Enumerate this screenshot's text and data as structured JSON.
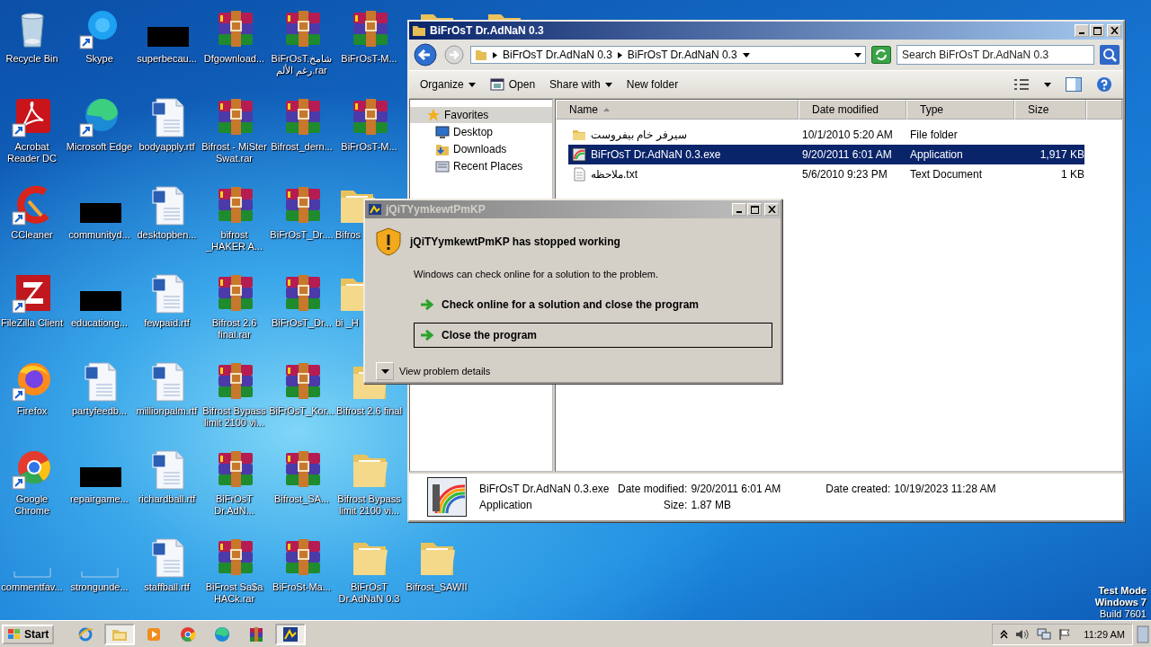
{
  "desktop": {
    "columns": [
      [
        {
          "label": "Recycle Bin",
          "kind": "recycle",
          "shortcut": false
        },
        {
          "label": "Acrobat Reader DC",
          "kind": "acrobat",
          "shortcut": true
        },
        {
          "label": "CCleaner",
          "kind": "ccleaner",
          "shortcut": true
        },
        {
          "label": "FileZilla Client",
          "kind": "filezilla",
          "shortcut": true
        },
        {
          "label": "Firefox",
          "kind": "firefox",
          "shortcut": true
        },
        {
          "label": "Google Chrome",
          "kind": "chrome",
          "shortcut": true
        },
        {
          "label": "commentfav...",
          "kind": "blank",
          "shortcut": false
        }
      ],
      [
        {
          "label": "Skype",
          "kind": "skype",
          "shortcut": true
        },
        {
          "label": "Microsoft Edge",
          "kind": "edge",
          "shortcut": true
        },
        {
          "label": "communityd...",
          "kind": "redacted",
          "shortcut": false
        },
        {
          "label": "educationg...",
          "kind": "redacted",
          "shortcut": false
        },
        {
          "label": "partyfeedb...",
          "kind": "word",
          "shortcut": false
        },
        {
          "label": "repairgame...",
          "kind": "redacted",
          "shortcut": false
        },
        {
          "label": "strongunde...",
          "kind": "blank",
          "shortcut": false
        }
      ],
      [
        {
          "label": "superbecau...",
          "kind": "redacted",
          "shortcut": false
        },
        {
          "label": "bodyapply.rtf",
          "kind": "word",
          "shortcut": false
        },
        {
          "label": "desktopben...",
          "kind": "word",
          "shortcut": false
        },
        {
          "label": "fewpaid.rtf",
          "kind": "word",
          "shortcut": false
        },
        {
          "label": "millionpalm.rtf",
          "kind": "word",
          "shortcut": false
        },
        {
          "label": "richardball.rtf",
          "kind": "word",
          "shortcut": false
        },
        {
          "label": "staffball.rtf",
          "kind": "word",
          "shortcut": false
        }
      ],
      [
        {
          "label": "Dfgownload...",
          "kind": "winrar",
          "shortcut": false
        },
        {
          "label": "Bifrost - MiSter Swat.rar",
          "kind": "winrar",
          "shortcut": false
        },
        {
          "label": "bifrost _HAKER A...",
          "kind": "winrar",
          "shortcut": false
        },
        {
          "label": "Bifrost 2.6 final.rar",
          "kind": "winrar",
          "shortcut": false
        },
        {
          "label": "Bifrost Bypass limit 2100 vi...",
          "kind": "winrar",
          "shortcut": false
        },
        {
          "label": "BiFrOsT Dr.AdN...",
          "kind": "winrar",
          "shortcut": false
        },
        {
          "label": "BiFrost Sa$a HACk.rar",
          "kind": "winrar",
          "shortcut": false
        }
      ],
      [
        {
          "label": "BiFrOsT.شامخ رغم الألم.rar",
          "kind": "winrar",
          "shortcut": false
        },
        {
          "label": "Bifrost_dern...",
          "kind": "winrar",
          "shortcut": false
        },
        {
          "label": "BiFrOsT_Dr....",
          "kind": "winrar",
          "shortcut": false
        },
        {
          "label": "BiFrOsT_Dr...",
          "kind": "winrar",
          "shortcut": false
        },
        {
          "label": "BiFrOsT_Kor...",
          "kind": "winrar",
          "shortcut": false
        },
        {
          "label": "Bifrost_SA...",
          "kind": "winrar",
          "shortcut": false
        },
        {
          "label": "BiFroSt-Ma...",
          "kind": "winrar",
          "shortcut": false
        }
      ],
      [
        {
          "label": "BiFrOsT-M...",
          "kind": "winrar",
          "shortcut": false
        },
        {
          "label": "BiFrOsT-M...",
          "kind": "winrar",
          "shortcut": false
        },
        {
          "label": "Bifros",
          "kind": "folder",
          "shortcut": false
        },
        {
          "label": "bi _H",
          "kind": "folder",
          "shortcut": false
        },
        {
          "label": "Bifrost 2.6 final",
          "kind": "folder",
          "shortcut": false
        },
        {
          "label": "Bifrost Bypass limit 2100 vi...",
          "kind": "folder",
          "shortcut": false
        },
        {
          "label": "BiFrOsT Dr.AdNaN 0.3",
          "kind": "folder",
          "shortcut": false
        }
      ],
      [
        {
          "kind": "folder"
        },
        null,
        null,
        null,
        null,
        null,
        {
          "label": "Bifrost_SAWII",
          "kind": "folder",
          "shortcut": false
        }
      ],
      [
        {
          "kind": "folder"
        }
      ]
    ]
  },
  "explorer": {
    "title": "BiFrOsT Dr.AdNaN 0.3",
    "address": [
      "BiFrOsT Dr.AdNaN 0.3",
      "BiFrOsT Dr.AdNaN 0.3"
    ],
    "search": {
      "placeholder": "Search BiFrOsT Dr.AdNaN 0.3"
    },
    "toolbar": [
      {
        "label": "Organize",
        "kind": "menu"
      },
      {
        "label": "Open",
        "kind": "icon"
      },
      {
        "label": "Share with",
        "kind": "menu"
      },
      {
        "label": "New folder",
        "kind": "plain"
      }
    ],
    "nav": [
      {
        "label": "Favorites",
        "kind": "group",
        "selected": true
      },
      {
        "label": "Desktop",
        "kind": "desktop",
        "selected": false
      },
      {
        "label": "Downloads",
        "kind": "downloads",
        "selected": false
      },
      {
        "label": "Recent Places",
        "kind": "recent",
        "selected": false
      }
    ],
    "columns": [
      {
        "label": "Name",
        "sorted": true
      },
      {
        "label": "Date modified",
        "sorted": false
      },
      {
        "label": "Type",
        "sorted": false
      },
      {
        "label": "Size",
        "sorted": false
      }
    ],
    "files": [
      {
        "name": "سيرفر خام بيفروست",
        "date": "10/1/2010 5:20 AM",
        "type": "File folder",
        "kind": "folder",
        "selected": false
      },
      {
        "name": "BiFrOsT Dr.AdNaN 0.3.exe",
        "date": "9/20/2011 6:01 AM",
        "type": "Application",
        "size": "1,917 KB",
        "kind": "exe",
        "selected": true
      },
      {
        "name": "ملاحظه.txt",
        "date": "5/6/2010 9:23 PM",
        "type": "Text Document",
        "size": "1 KB",
        "kind": "text",
        "selected": false
      }
    ],
    "details": {
      "name": "BiFrOsT Dr.AdNaN 0.3.exe",
      "type": "Application",
      "fields": [
        {
          "label": "Date modified:",
          "value": "9/20/2011 6:01 AM"
        },
        {
          "label": "Size:",
          "value": "1.87 MB"
        },
        {
          "label": "Date created:",
          "value": "10/19/2023 11:28 AM"
        }
      ]
    }
  },
  "dialog": {
    "title": "jQiTYymkewtPmKP",
    "heading": "jQiTYymkewtPmKP has stopped working",
    "message": "Windows can check online for a solution to the problem.",
    "commands": [
      {
        "label": "Check online for a solution and close the program",
        "focused": false
      },
      {
        "label": "Close the program",
        "focused": true
      }
    ],
    "details_toggle": "View problem details"
  },
  "system_notice": [
    "Test Mode",
    "Windows 7",
    "Build 7601"
  ],
  "taskbar": {
    "start": "Start",
    "apps": [
      {
        "kind": "ie",
        "active": false
      },
      {
        "kind": "explorer",
        "active": true
      },
      {
        "kind": "media",
        "active": false
      },
      {
        "kind": "chrome",
        "active": false
      },
      {
        "kind": "edge",
        "active": false
      },
      {
        "kind": "winrar",
        "active": false
      },
      {
        "kind": "app",
        "active": true
      }
    ],
    "clock": "11:29 AM"
  }
}
